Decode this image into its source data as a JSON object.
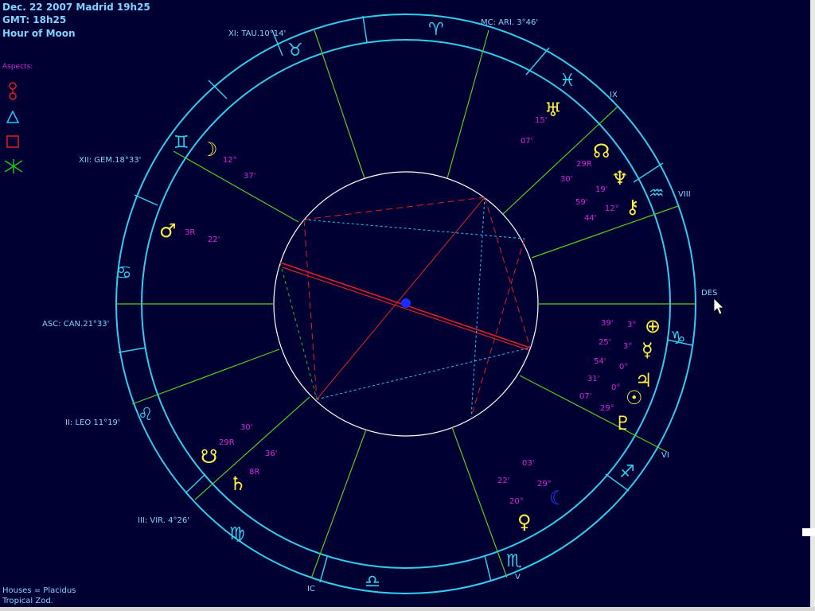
{
  "header": {
    "line1": "Dec. 22 2007 Madrid  19h25",
    "line2": "GMT: 18h25",
    "line3": "Hour of Moon"
  },
  "aspects": {
    "title": "Aspects:",
    "items": [
      {
        "name": "opposition",
        "color": "#e02020"
      },
      {
        "name": "trine",
        "color": "#20c8ff"
      },
      {
        "name": "square",
        "color": "#e02020"
      },
      {
        "name": "sextile",
        "color": "#20c020"
      }
    ]
  },
  "footer": {
    "houses": "Houses = Placidus",
    "zodiac": "Tropical Zod."
  },
  "cusps": {
    "xi": "XI: TAU.10°14'",
    "mc": "MC: ARI. 3°46'",
    "ix": "IX",
    "viii": "VIII",
    "des": "DES",
    "vi": "VI",
    "v": "V",
    "ic": "IC",
    "iii": "III: VIR. 4°26'",
    "ii": "II: LEO 11°19'",
    "asc": "ASC: CAN.21°33'",
    "xii": "XII: GEM.18°33'"
  },
  "degrees": {
    "d15": "15'",
    "d07a": "07'",
    "d29R": "29R",
    "d30": "30'",
    "d19": "19'",
    "d59": "59'",
    "d12a": "12°",
    "d44": "44'",
    "d12b": "12°",
    "d37": "37'",
    "d3R": "3R",
    "d22a": "22'",
    "d39": "39'",
    "d3a": "3°",
    "d25": "25'",
    "d3b": "3°",
    "d54": "54'",
    "d0a": "0°",
    "d31": "31'",
    "d0b": "0°",
    "d07b": "07'",
    "d29b": "29°",
    "d03": "03'",
    "d22b": "22'",
    "d29c": "29°",
    "d20": "20°",
    "d30b": "30'",
    "d29R2": "29R",
    "d36": "36'",
    "d8R": "8R"
  },
  "colors": {
    "background": "#000033",
    "ring": "#33ccee",
    "house_line": "#55cc22",
    "inner_circle": "#ffffff",
    "planet": "#ffee44",
    "degree_text": "#dd22dd",
    "label_text": "#7fd4ff"
  }
}
